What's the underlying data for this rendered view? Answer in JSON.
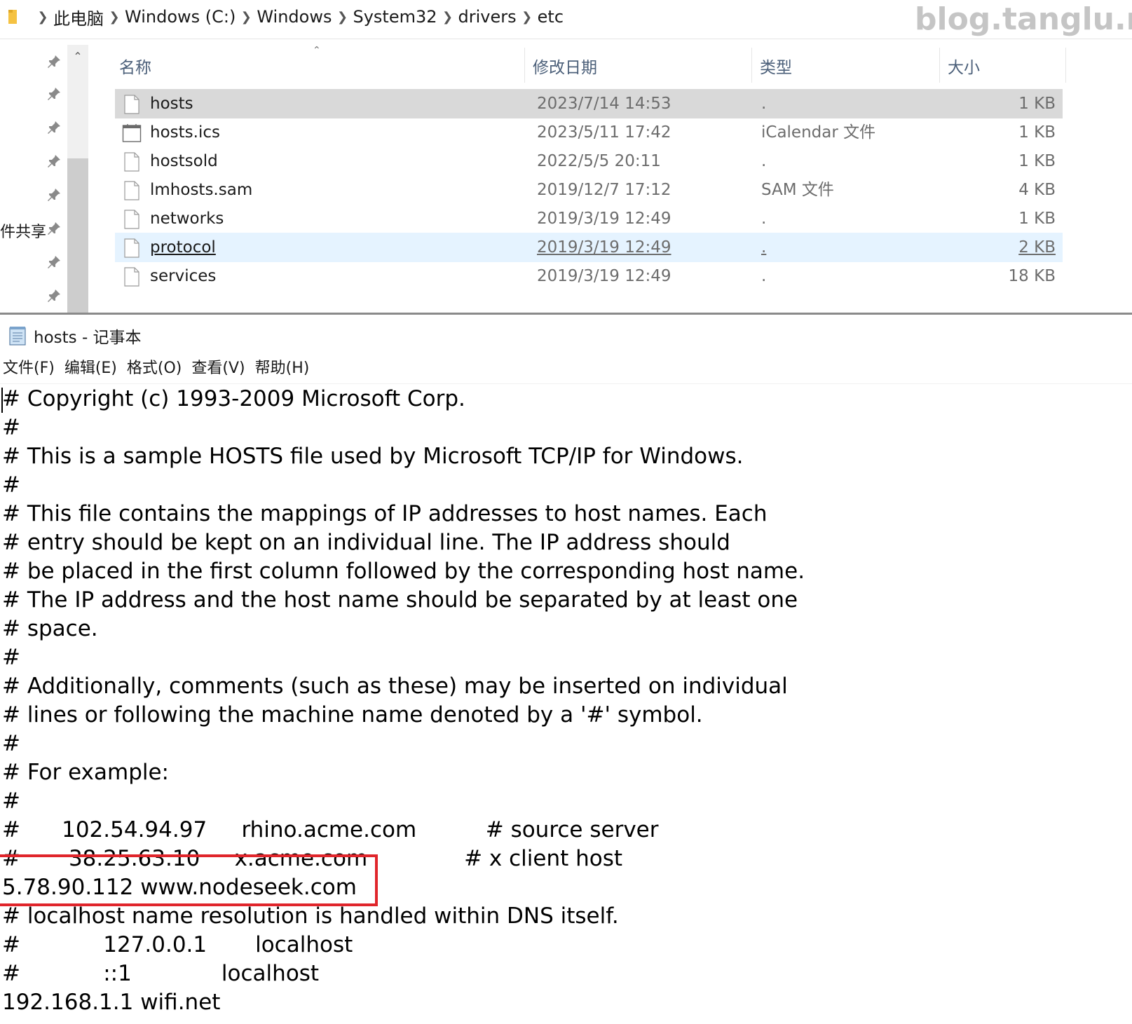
{
  "explorer": {
    "breadcrumb": [
      "此电脑",
      "Windows (C:)",
      "Windows",
      "System32",
      "drivers",
      "etc"
    ],
    "watermark": "blog.tanglu.me",
    "nav_label": "件共享",
    "columns": {
      "name": "名称",
      "date": "修改日期",
      "type": "类型",
      "size": "大小"
    },
    "files": [
      {
        "name": "hosts",
        "date": "2023/7/14 14:53",
        "type": ".",
        "size": "1 KB",
        "icon": "file-icon"
      },
      {
        "name": "hosts.ics",
        "date": "2023/5/11 17:42",
        "type": "iCalendar 文件",
        "size": "1 KB",
        "icon": "calendar-file-icon"
      },
      {
        "name": "hostsold",
        "date": "2022/5/5 20:11",
        "type": ".",
        "size": "1 KB",
        "icon": "file-icon"
      },
      {
        "name": "lmhosts.sam",
        "date": "2019/12/7 17:12",
        "type": "SAM 文件",
        "size": "4 KB",
        "icon": "file-icon"
      },
      {
        "name": "networks",
        "date": "2019/3/19 12:49",
        "type": ".",
        "size": "1 KB",
        "icon": "file-icon"
      },
      {
        "name": "protocol",
        "date": "2019/3/19 12:49",
        "type": ".",
        "size": "2 KB",
        "icon": "file-icon"
      },
      {
        "name": "services",
        "date": "2019/3/19 12:49",
        "type": ".",
        "size": "18 KB",
        "icon": "file-icon"
      }
    ],
    "selected_file": "hosts",
    "hovered_file": "protocol"
  },
  "notepad": {
    "title": "hosts - 记事本",
    "menu": [
      "文件(F)",
      "编辑(E)",
      "格式(O)",
      "查看(V)",
      "帮助(H)"
    ],
    "lines": [
      "# Copyright (c) 1993-2009 Microsoft Corp.",
      "#",
      "# This is a sample HOSTS file used by Microsoft TCP/IP for Windows.",
      "#",
      "# This file contains the mappings of IP addresses to host names. Each",
      "# entry should be kept on an individual line. The IP address should",
      "# be placed in the first column followed by the corresponding host name.",
      "# The IP address and the host name should be separated by at least one",
      "# space.",
      "#",
      "# Additionally, comments (such as these) may be inserted on individual",
      "# lines or following the machine name denoted by a '#' symbol.",
      "#",
      "# For example:",
      "#",
      "#      102.54.94.97     rhino.acme.com          # source server",
      "#       38.25.63.10     x.acme.com              # x client host",
      "5.78.90.112 www.nodeseek.com",
      "# localhost name resolution is handled within DNS itself.",
      "#            127.0.0.1       localhost",
      "#            ::1             localhost",
      "192.168.1.1 wifi.net"
    ],
    "highlight_color": "#e0252b"
  }
}
